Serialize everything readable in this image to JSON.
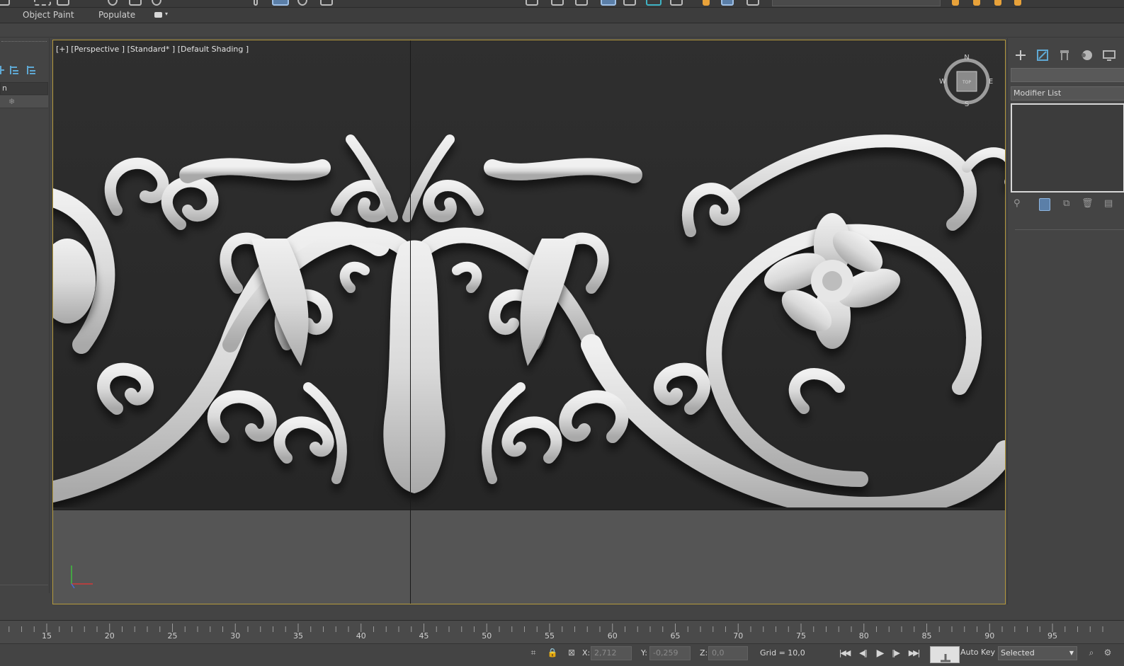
{
  "ribbon": {
    "tabs": [
      "Object Paint",
      "Populate"
    ]
  },
  "scene_explorer": {
    "column_header": "n",
    "row_icon": "snowflake-icon"
  },
  "viewport": {
    "label": "[+] [Perspective ] [Standard* ] [Default Shading ]",
    "viewcube": {
      "north": "N",
      "south": "S",
      "east": "E",
      "west": "W",
      "face": "TOP"
    }
  },
  "command_panel": {
    "modifier_list_label": "Modifier List",
    "tabs": [
      "create-icon",
      "modify-icon",
      "hierarchy-icon",
      "motion-icon",
      "display-icon"
    ]
  },
  "timeline": {
    "ticks": [
      "15",
      "20",
      "25",
      "30",
      "35",
      "40",
      "45",
      "50",
      "55",
      "60",
      "65",
      "70",
      "75",
      "80",
      "85",
      "90",
      "95"
    ]
  },
  "status": {
    "x_label": "X:",
    "x_value": "2,712",
    "y_label": "Y:",
    "y_value": "-0,259",
    "z_label": "Z:",
    "z_value": "0,0",
    "grid": "Grid = 10,0",
    "auto_key": "Auto Key",
    "selection_filter": "Selected"
  },
  "colors": {
    "viewport_border": "#b59a3d",
    "accent": "#5fa8d3"
  }
}
